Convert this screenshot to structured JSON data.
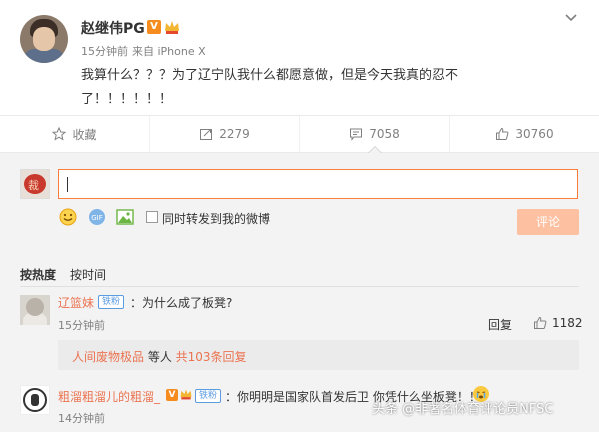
{
  "post": {
    "username": "赵继伟PG",
    "v_badge": "V",
    "time": "15分钟前",
    "source": "来自 iPhone X",
    "content": "我算什么？？？为了辽宁队我什么都愿意做，但是今天我真的忍不了！！！！！！"
  },
  "actions": {
    "favorite_label": "收藏",
    "repost_count": "2279",
    "comment_count": "7058",
    "like_count": "30760"
  },
  "composer": {
    "repost_label": "同时转发到我的微博",
    "submit_label": "评论"
  },
  "sort": {
    "by_heat": "按热度",
    "by_time": "按时间"
  },
  "comments": [
    {
      "name": "辽篮妹",
      "badge": "铁粉",
      "text": "：为什么成了板凳?",
      "time": "15分钟前",
      "reply_label": "回复",
      "likes": "1182",
      "sub": {
        "name": "人间废物极品",
        "mid": " 等人 ",
        "count": "共103条回复"
      }
    },
    {
      "name": "粗溜粗溜儿的粗溜_",
      "v_badge": "V",
      "badge": "铁粉",
      "text": "：你明明是国家队首发后卫 你凭什么坐板凳！！",
      "time": "14分钟前"
    }
  ],
  "watermark": "头条 @非著名体育评论员NFSC",
  "colors": {
    "accent": "#eb7350",
    "focus_border": "#fa7d3c",
    "submit_disabled": "#fdc0a0",
    "badge_blue": "#5b9be0"
  }
}
